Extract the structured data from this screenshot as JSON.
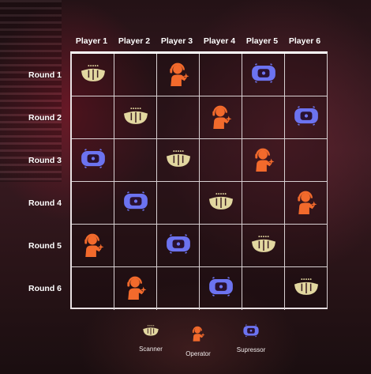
{
  "columns": [
    "Player 1",
    "Player 2",
    "Player 3",
    "Player 4",
    "Player 5",
    "Player 6"
  ],
  "rows": [
    "Round 1",
    "Round 2",
    "Round 3",
    "Round 4",
    "Round 5",
    "Round 6"
  ],
  "grid": [
    [
      "scanner",
      "",
      "operator",
      "",
      "supressor",
      ""
    ],
    [
      "",
      "scanner",
      "",
      "operator",
      "",
      "supressor"
    ],
    [
      "supressor",
      "",
      "scanner",
      "",
      "operator",
      ""
    ],
    [
      "",
      "supressor",
      "",
      "scanner",
      "",
      "operator"
    ],
    [
      "operator",
      "",
      "supressor",
      "",
      "scanner",
      ""
    ],
    [
      "",
      "operator",
      "",
      "supressor",
      "",
      "scanner"
    ]
  ],
  "legend": [
    {
      "key": "scanner",
      "label": "Scanner"
    },
    {
      "key": "operator",
      "label": "Operator"
    },
    {
      "key": "supressor",
      "label": "Supressor"
    }
  ],
  "colors": {
    "scanner": "#e2d7a0",
    "operator": "#f26a2c",
    "supressor": "#6c73f0",
    "grid_line": "#d8d0d2"
  },
  "icons": {
    "scanner": "scanner-icon",
    "operator": "operator-icon",
    "supressor": "supressor-icon"
  }
}
